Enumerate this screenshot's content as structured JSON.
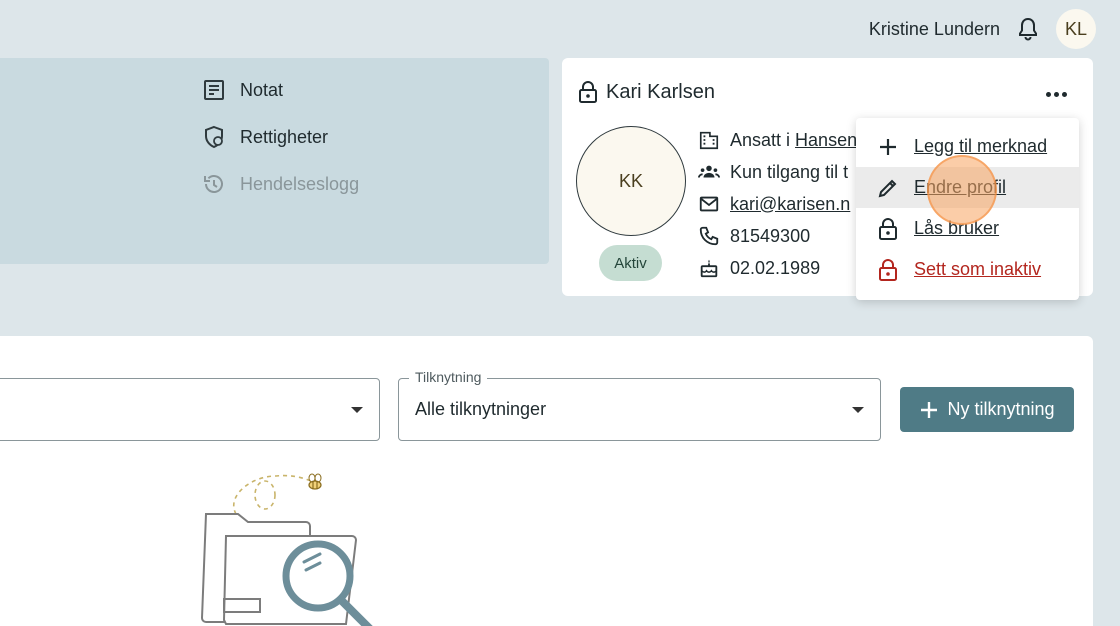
{
  "header": {
    "user_name": "Kristine Lundern",
    "avatar_initials": "KL"
  },
  "nav": {
    "items": [
      {
        "label": "Notat",
        "icon": "note-icon",
        "enabled": true
      },
      {
        "label": "Rettigheter",
        "icon": "shield-user-icon",
        "enabled": true
      },
      {
        "label": "Hendelseslogg",
        "icon": "history-icon",
        "enabled": false
      }
    ]
  },
  "profile": {
    "name": "Kari Karlsen",
    "initials": "KK",
    "status": "Aktiv",
    "employer_prefix": "Ansatt i",
    "employer_link": "Hansen",
    "access": "Kun tilgang til t",
    "email": "kari@karisen.n",
    "phone": "81549300",
    "birthdate": "02.02.1989"
  },
  "menu": {
    "items": [
      {
        "label": "Legg til merknad",
        "icon": "plus-icon"
      },
      {
        "label": "Endre profil",
        "icon": "pencil-icon"
      },
      {
        "label": "Lås bruker",
        "icon": "lock-icon"
      },
      {
        "label": "Sett som inaktiv",
        "icon": "lock-red-icon"
      }
    ]
  },
  "filters": {
    "tilknytning_label": "Tilknytning",
    "tilknytning_value": "Alle tilknytninger",
    "new_button": "Ny tilknytning"
  },
  "colors": {
    "background": "#dde6ea",
    "nav_panel": "#c9dae0",
    "primary_button": "#4f7b86",
    "status_chip": "#c5ddd2",
    "danger": "#b3261e"
  }
}
